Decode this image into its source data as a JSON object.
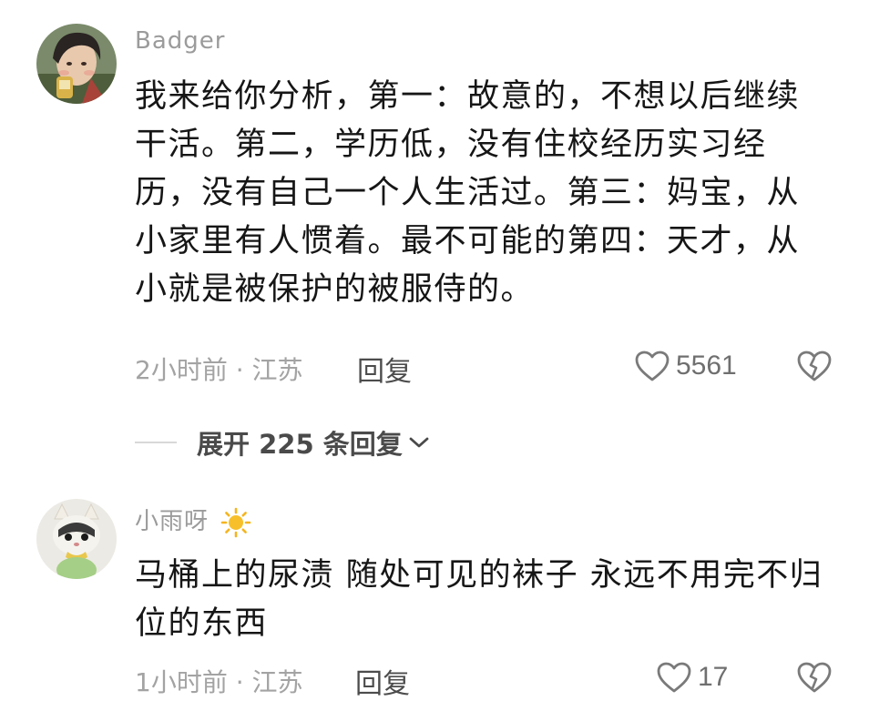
{
  "comments": [
    {
      "username": "Badger",
      "text": "我来给你分析，第一：故意的，不想以后继续干活。第二，学历低，没有住校经历实习经历，没有自己一个人生活过。第三：妈宝，从小家里有人惯着。最不可能的第四：天才，从小就是被保护的被服侍的。",
      "meta": "2小时前 · 江苏",
      "reply_label": "回复",
      "likes": "5561"
    },
    {
      "username": "小雨呀",
      "text": "马桶上的尿渍  随处可见的袜子 永远不用完不归位的东西",
      "meta": "1小时前 · 江苏",
      "reply_label": "回复",
      "likes": "17"
    }
  ],
  "expand_replies_label": "展开 225 条回复",
  "colors": {
    "username": "#9b9b9b",
    "body_text": "#161616",
    "meta": "#a3a3a3",
    "icon": "#7a7a7a",
    "background": "#ffffff"
  },
  "icons": {
    "like": "heart-outline-icon",
    "dislike": "broken-heart-icon",
    "expand": "chevron-down-icon",
    "username_badge": "sun-icon"
  }
}
